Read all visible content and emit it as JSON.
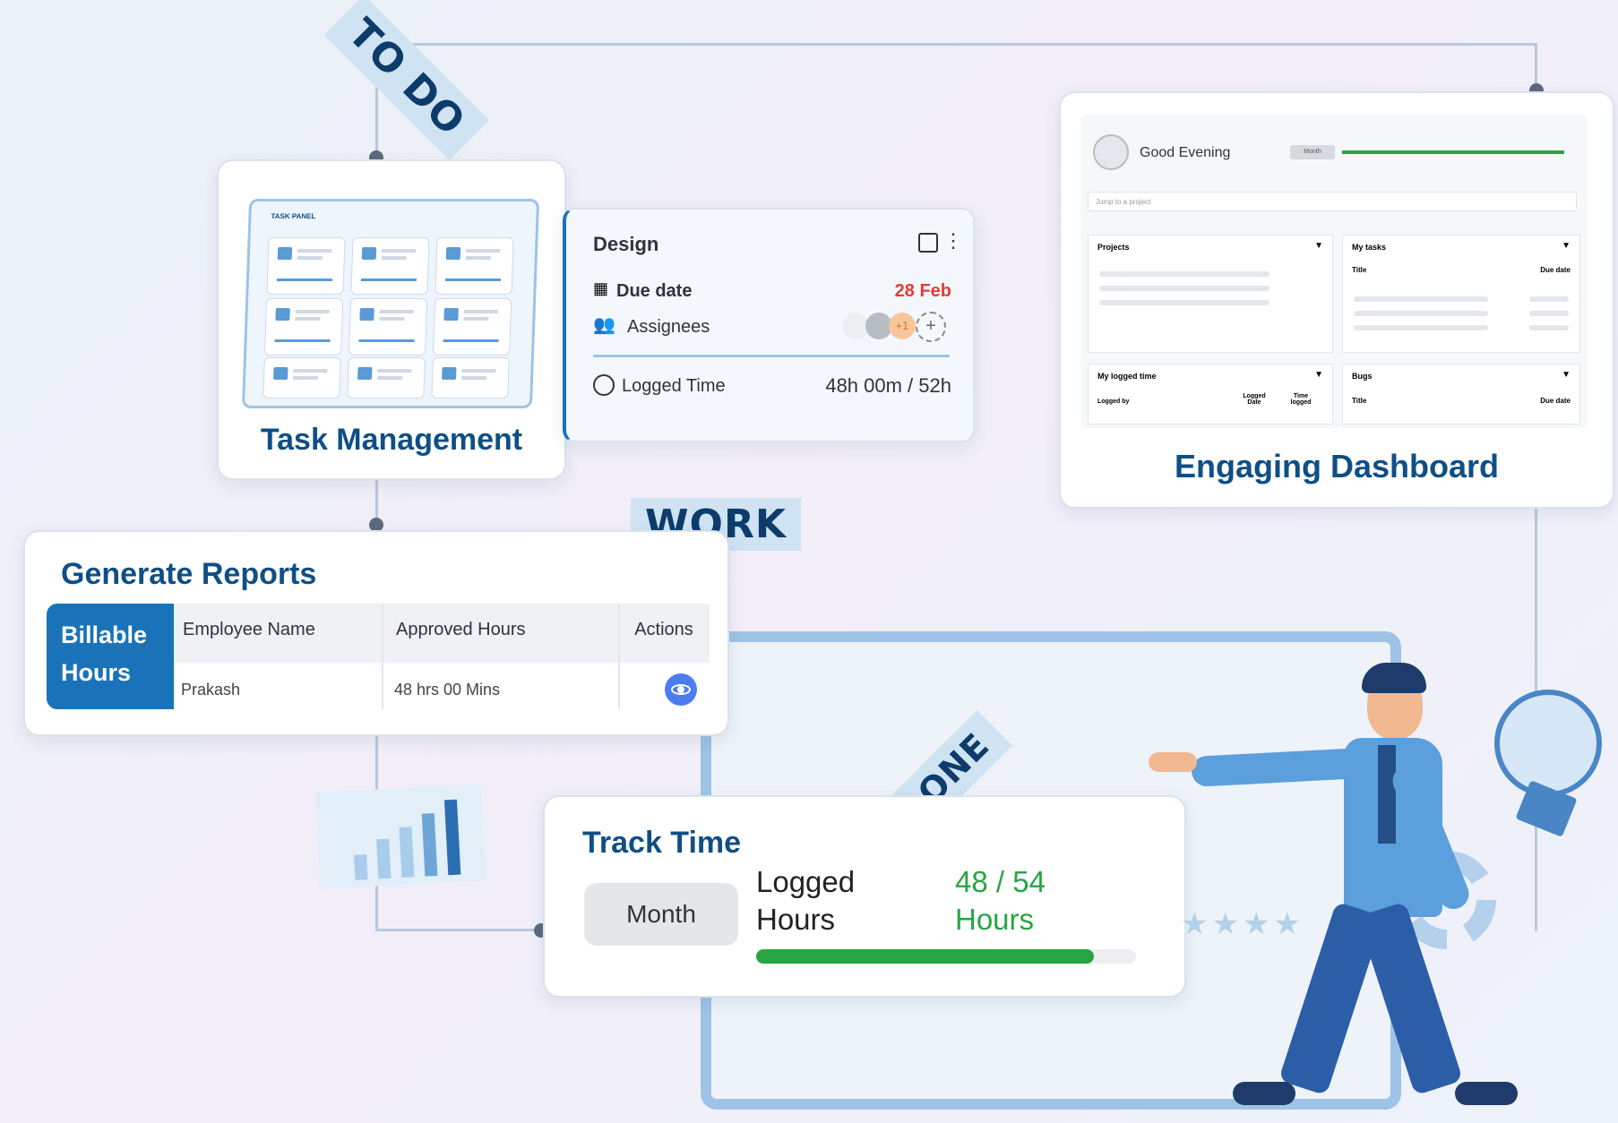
{
  "stamps": {
    "todo": "TO DO",
    "work": "WORK",
    "done": "DONE"
  },
  "task_management": {
    "title": "Task Management",
    "panel_label": "TASK PANEL"
  },
  "design_card": {
    "title": "Design",
    "due_label": "Due date",
    "due_value": "28 Feb",
    "assignees_label": "Assignees",
    "extra_count": "+1",
    "logged_label": "Logged Time",
    "logged_value": "48h 00m / 52h"
  },
  "dashboard": {
    "title": "Engaging Dashboard",
    "greeting": "Good Evening",
    "period": "Month",
    "search_placeholder": "Jump to a project",
    "widgets": {
      "projects": "Projects",
      "my_tasks": "My tasks",
      "my_tasks_col1": "Title",
      "my_tasks_col2": "Due date",
      "logged_time": "My logged time",
      "logged_col1": "Logged by",
      "logged_col2": "Logged Date",
      "logged_col3": "Time logged",
      "bugs": "Bugs",
      "bugs_col1": "Title",
      "bugs_col2": "Due date"
    }
  },
  "reports": {
    "title": "Generate Reports",
    "side_label_1": "Billable",
    "side_label_2": "Hours",
    "columns": [
      "Employee Name",
      "Approved Hours",
      "Actions"
    ],
    "rows": [
      {
        "employee": "Prakash",
        "hours": "48 hrs 00 Mins"
      }
    ]
  },
  "track_time": {
    "title": "Track Time",
    "period_button": "Month",
    "logged_label_1": "Logged",
    "logged_label_2": "Hours",
    "value_1": "48 / 54",
    "value_2": "Hours",
    "progress": 0.89
  },
  "colors": {
    "navy": "#0f4f86",
    "accent_blue": "#1a73b8",
    "green": "#27a543",
    "red": "#e53935"
  },
  "icons": [
    "calendar-icon",
    "users-icon",
    "clock-icon",
    "eye-icon",
    "checkbox-icon",
    "kebab-icon",
    "avatar-icon",
    "lightbulb-icon",
    "chart-icon",
    "gear-icon",
    "star-icon"
  ]
}
